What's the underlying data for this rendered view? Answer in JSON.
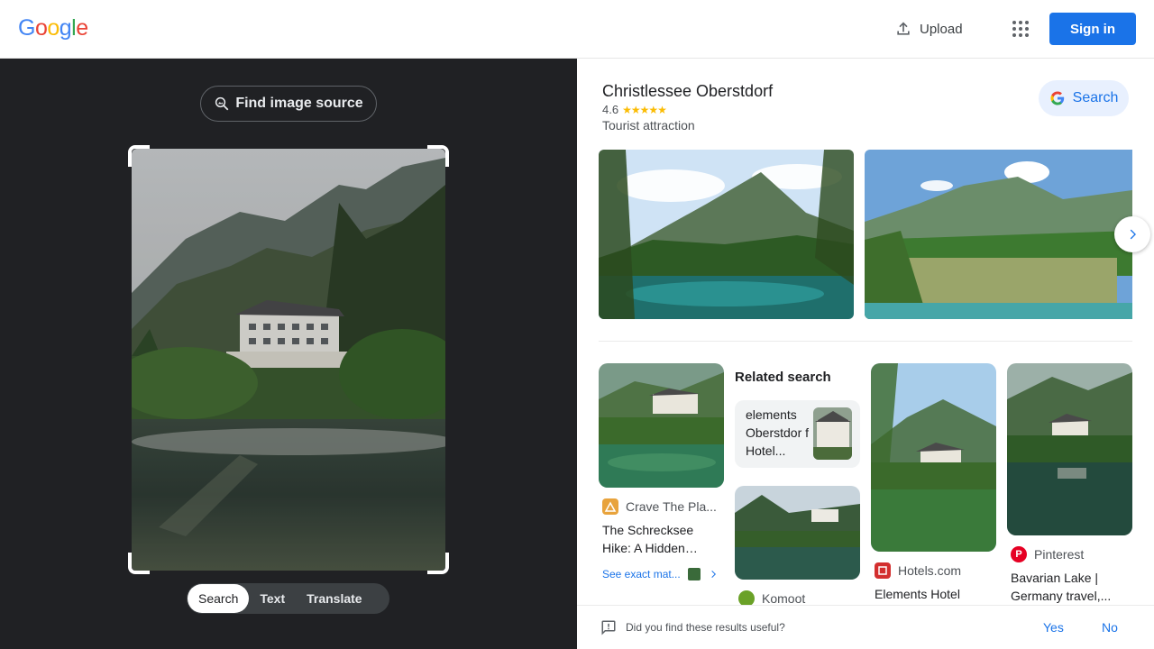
{
  "header": {
    "logo": [
      "G",
      "o",
      "o",
      "g",
      "l",
      "e"
    ],
    "logo_colors": [
      "#4285f4",
      "#ea4335",
      "#fbbc05",
      "#4285f4",
      "#34a853",
      "#ea4335"
    ],
    "upload_label": "Upload",
    "apps_icon": "apps-grid-icon",
    "signin_label": "Sign in"
  },
  "left": {
    "find_source_label": "Find image source",
    "modes": [
      "Search",
      "Text",
      "Translate"
    ],
    "active_mode": "Search"
  },
  "knowledge_panel": {
    "title": "Christlessee Oberstdorf",
    "rating": "4.6",
    "stars": "★★★★★",
    "type": "Tourist attraction",
    "search_label": "Search"
  },
  "results": [
    {
      "source": "Crave The Pla...",
      "title_line1": "The Schrecksee",
      "title_line2": "Hike: A Hidden…",
      "favicon_color": "#e8a33c"
    },
    {
      "source": "Komoot",
      "title_line1": "",
      "title_line2": "",
      "favicon_color": "#6aa127"
    },
    {
      "source": "Hotels.com",
      "title_line1": "Elements Hotel",
      "title_line2": "",
      "favicon_color": "#d32f2f"
    },
    {
      "source": "Pinterest",
      "title_line1": "Bavarian Lake |",
      "title_line2": "Germany travel,...",
      "favicon_color": "#e60023"
    }
  ],
  "see_exact_matches": "See exact mat...",
  "related": {
    "heading": "Related search",
    "item_text": "elements Oberstdor f Hotel..."
  },
  "feedback": {
    "question": "Did you find these results useful?",
    "yes": "Yes",
    "no": "No"
  },
  "colors": {
    "brand_blue": "#1a73e8",
    "dark_panel": "#202124",
    "star": "#fbbc04"
  }
}
